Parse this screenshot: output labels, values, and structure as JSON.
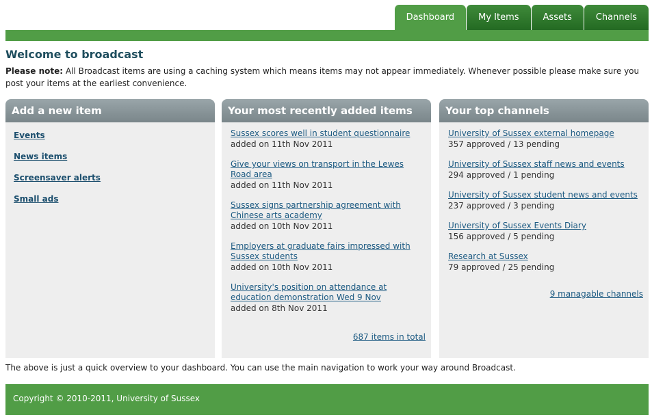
{
  "nav": {
    "tabs": [
      {
        "label": "Dashboard"
      },
      {
        "label": "My Items"
      },
      {
        "label": "Assets"
      },
      {
        "label": "Channels"
      }
    ]
  },
  "page": {
    "title": "Welcome to broadcast",
    "note_label": "Please note:",
    "note_text": " All Broadcast items are using a caching system which means items may not appear immediately. Whenever possible please make sure you post your items at the earliest convenience."
  },
  "add_panel": {
    "title": "Add a new item",
    "links": [
      "Events",
      "News items",
      "Screensaver alerts",
      "Small ads"
    ]
  },
  "recent_panel": {
    "title": "Your most recently added items",
    "items": [
      {
        "title": "Sussex scores well in student questionnaire",
        "meta": "added on 11th Nov 2011"
      },
      {
        "title": "Give your views on transport in the Lewes Road area",
        "meta": "added on 11th Nov 2011"
      },
      {
        "title": "Sussex signs partnership agreement with Chinese arts academy",
        "meta": "added on 10th Nov 2011"
      },
      {
        "title": "Employers at graduate fairs impressed with Sussex students",
        "meta": "added on 10th Nov 2011"
      },
      {
        "title": "University's position on attendance at education demonstration Wed 9 Nov",
        "meta": "added on 8th Nov 2011"
      }
    ],
    "total_link": "687 items in total"
  },
  "channels_panel": {
    "title": "Your top channels",
    "channels": [
      {
        "name": "University of Sussex external homepage",
        "stats": "357 approved / 13 pending"
      },
      {
        "name": "University of Sussex staff news and events",
        "stats": "294 approved / 1 pending"
      },
      {
        "name": "University of Sussex student news and events",
        "stats": "237 approved / 3 pending"
      },
      {
        "name": "University of Sussex Events Diary",
        "stats": "156 approved / 5 pending"
      },
      {
        "name": "Research at Sussex",
        "stats": "79 approved / 25 pending"
      }
    ],
    "manage_link": "9 managable channels"
  },
  "overview_text": "The above is just a quick overview to your dashboard. You can use the main navigation to work your way around Broadcast.",
  "footer": {
    "copyright": "Copyright © 2010-2011, University of Sussex"
  },
  "colors": {
    "brand_green": "#519d46",
    "tab_dark_green": "#236a22",
    "panel_header_grey": "#7a868a",
    "link_blue": "#1c5a82"
  }
}
